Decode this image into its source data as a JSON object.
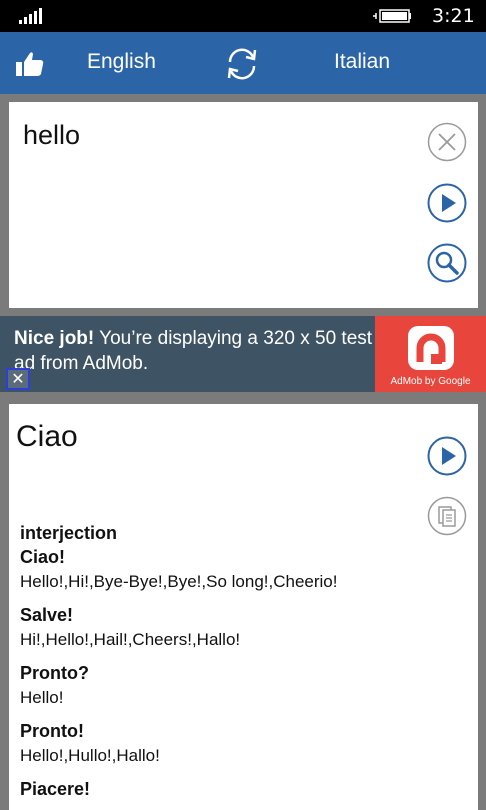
{
  "status_bar": {
    "time": "3:21"
  },
  "header": {
    "source_language": "English",
    "target_language": "Italian"
  },
  "input": {
    "text": "hello"
  },
  "ad": {
    "bold_text": "Nice job!",
    "text": " You’re displaying a 320 x 50 test ad from AdMob.",
    "brand": "AdMob by Google",
    "close_glyph": "✕"
  },
  "output": {
    "translation": "Ciao",
    "part_of_speech": "interjection",
    "entries": [
      {
        "word": "Ciao!",
        "meanings": "Hello!,Hi!,Bye-Bye!,Bye!,So long!,Cheerio!"
      },
      {
        "word": "Salve!",
        "meanings": "Hi!,Hello!,Hail!,Cheers!,Hallo!"
      },
      {
        "word": "Pronto?",
        "meanings": "Hello!"
      },
      {
        "word": "Pronto!",
        "meanings": "Hello!,Hullo!,Hallo!"
      },
      {
        "word": "Piacere!",
        "meanings": ""
      }
    ]
  },
  "icons": {
    "like": "thumbs-up-icon",
    "swap": "swap-languages-icon",
    "clear": "clear-icon",
    "play": "play-icon",
    "search": "search-icon",
    "copy": "copy-icon"
  },
  "colors": {
    "header": "#2c64a8",
    "accent": "#2c64a8",
    "background": "#7b7b7b",
    "ad_background": "#3e5363",
    "ad_logo": "#e8453c"
  }
}
